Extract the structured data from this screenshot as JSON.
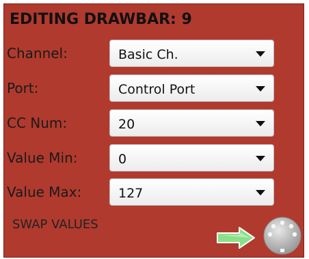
{
  "panel": {
    "title": "EDITING DRAWBAR: 9",
    "background_color": "#b03a2e"
  },
  "fields": [
    {
      "label": "Channel:",
      "value": "Basic Ch."
    },
    {
      "label": "Port:",
      "value": "Control Port"
    },
    {
      "label": "CC Num:",
      "value": "20"
    },
    {
      "label": "Value Min:",
      "value": "0"
    },
    {
      "label": "Value Max:",
      "value": "127"
    }
  ],
  "actions": {
    "swap_label": "SWAP VALUES",
    "arrow_icon": "right-arrow-icon",
    "arrow_color": "#7dd87d",
    "midi_icon": "midi-connector-icon"
  }
}
